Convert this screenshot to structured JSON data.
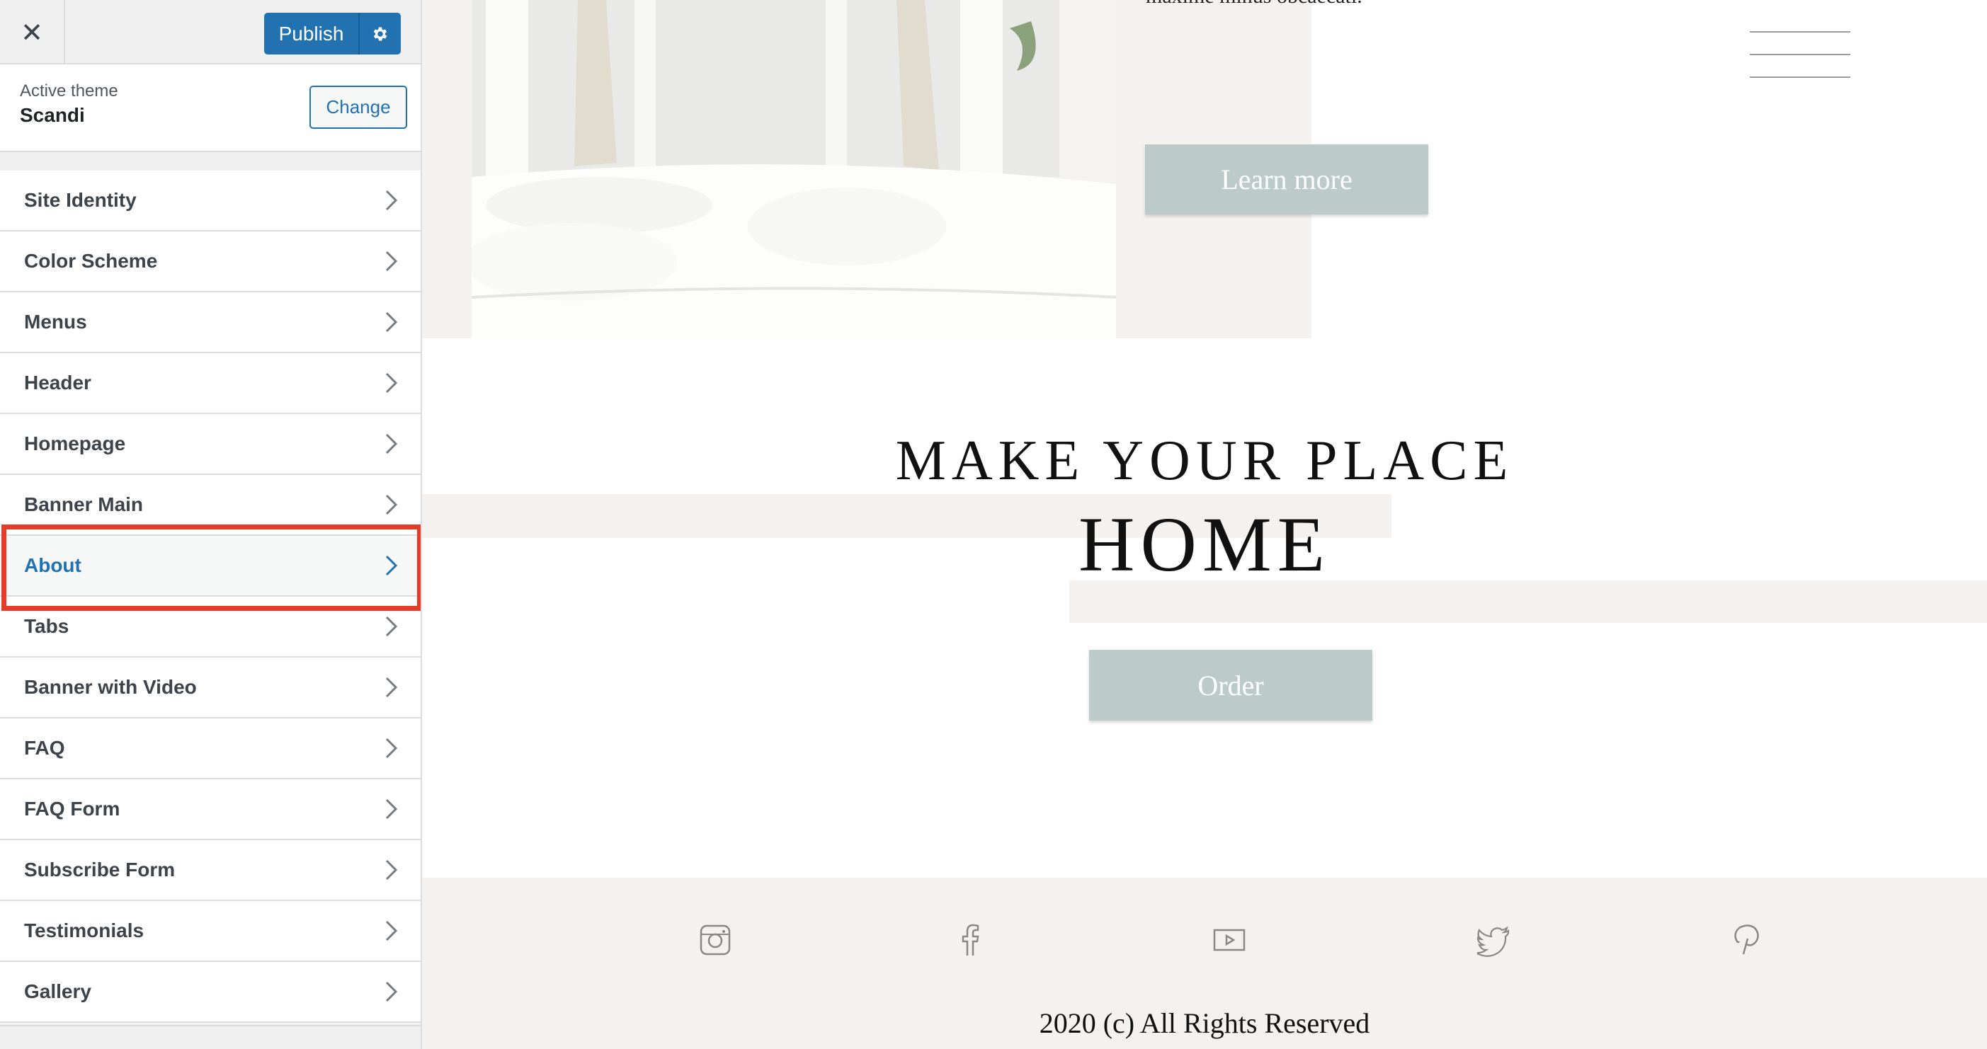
{
  "sidebar": {
    "close_icon": "close-icon",
    "publish_label": "Publish",
    "settings_icon": "gear-icon",
    "active_theme_label": "Active theme",
    "active_theme_name": "Scandi",
    "change_label": "Change",
    "active_item": "About",
    "highlight_color": "#e53b28",
    "accent_color": "#2271b1",
    "items": [
      {
        "label": "Site Identity"
      },
      {
        "label": "Color Scheme"
      },
      {
        "label": "Menus"
      },
      {
        "label": "Header"
      },
      {
        "label": "Homepage"
      },
      {
        "label": "Banner Main"
      },
      {
        "label": "About"
      },
      {
        "label": "Tabs"
      },
      {
        "label": "Banner with Video"
      },
      {
        "label": "FAQ"
      },
      {
        "label": "FAQ Form"
      },
      {
        "label": "Subscribe Form"
      },
      {
        "label": "Testimonials"
      },
      {
        "label": "Gallery"
      }
    ]
  },
  "preview": {
    "hero_text": "maxime minus obcaecati.",
    "learn_more_label": "Learn more",
    "headline_line1": "MAKE YOUR PLACE",
    "headline_line2": "HOME",
    "order_label": "Order",
    "button_color": "#bccbca",
    "beige_color": "#f4f1ee",
    "social_icons": [
      "instagram-icon",
      "facebook-icon",
      "youtube-icon",
      "twitter-icon",
      "pinterest-icon"
    ],
    "copyright": "2020 (c) All Rights Reserved"
  }
}
